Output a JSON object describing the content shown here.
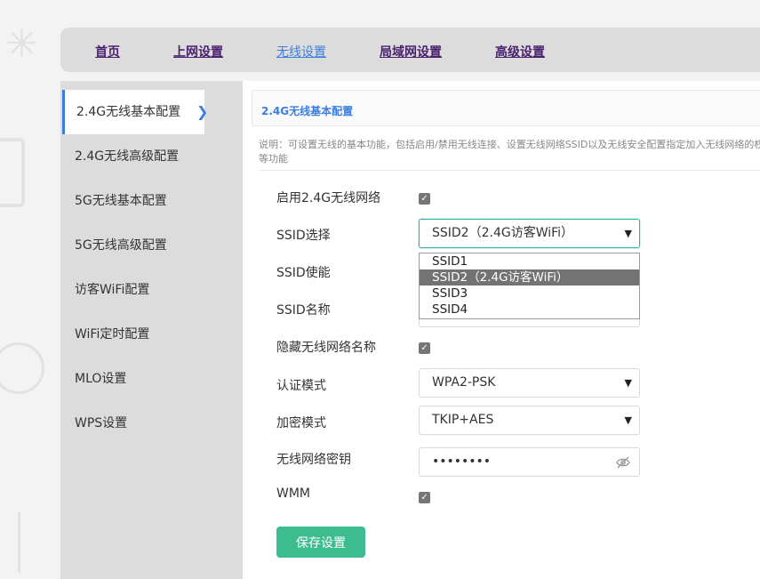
{
  "nav": {
    "items": [
      {
        "label": "首页",
        "active": false
      },
      {
        "label": "上网设置",
        "active": false
      },
      {
        "label": "无线设置",
        "active": true
      },
      {
        "label": "局域网设置",
        "active": false
      },
      {
        "label": "高级设置",
        "active": false
      }
    ]
  },
  "sidebar": {
    "items": [
      {
        "label": "2.4G无线基本配置",
        "active": true
      },
      {
        "label": "2.4G无线高级配置",
        "active": false
      },
      {
        "label": "5G无线基本配置",
        "active": false
      },
      {
        "label": "5G无线高级配置",
        "active": false
      },
      {
        "label": "访客WiFi配置",
        "active": false
      },
      {
        "label": "WiFi定时配置",
        "active": false
      },
      {
        "label": "MLO设置",
        "active": false
      },
      {
        "label": "WPS设置",
        "active": false
      }
    ]
  },
  "panel": {
    "title": "2.4G无线基本配置",
    "description": "说明：可设置无线的基本功能，包括启用/禁用无线连接、设置无线网络SSID以及无线安全配置指定加入无线网络的权限等功能"
  },
  "form": {
    "enable_label": "启用2.4G无线网络",
    "enable_checked": true,
    "ssid_select_label": "SSID选择",
    "ssid_select_value": "SSID2（2.4G访客WiFi）",
    "ssid_options": [
      "SSID1",
      "SSID2（2.4G访客WiFi）",
      "SSID3",
      "SSID4"
    ],
    "ssid_enable_label": "SSID使能",
    "ssid_name_label": "SSID名称",
    "hide_label": "隐藏无线网络名称",
    "hide_checked": true,
    "auth_label": "认证模式",
    "auth_value": "WPA2-PSK",
    "encrypt_label": "加密模式",
    "encrypt_value": "TKIP+AES",
    "key_label": "无线网络密钥",
    "key_value": "••••••••",
    "wmm_label": "WMM",
    "wmm_checked": true,
    "save_label": "保存设置"
  },
  "icons": {
    "chevron": "chevron-right-icon",
    "check": "check-icon",
    "caret": "chevron-down-icon",
    "eye": "eye-off-icon"
  },
  "colors": {
    "accent": "#3c7ee0",
    "save_button": "#3dbd8f",
    "nav_link": "#4a1f6e"
  }
}
